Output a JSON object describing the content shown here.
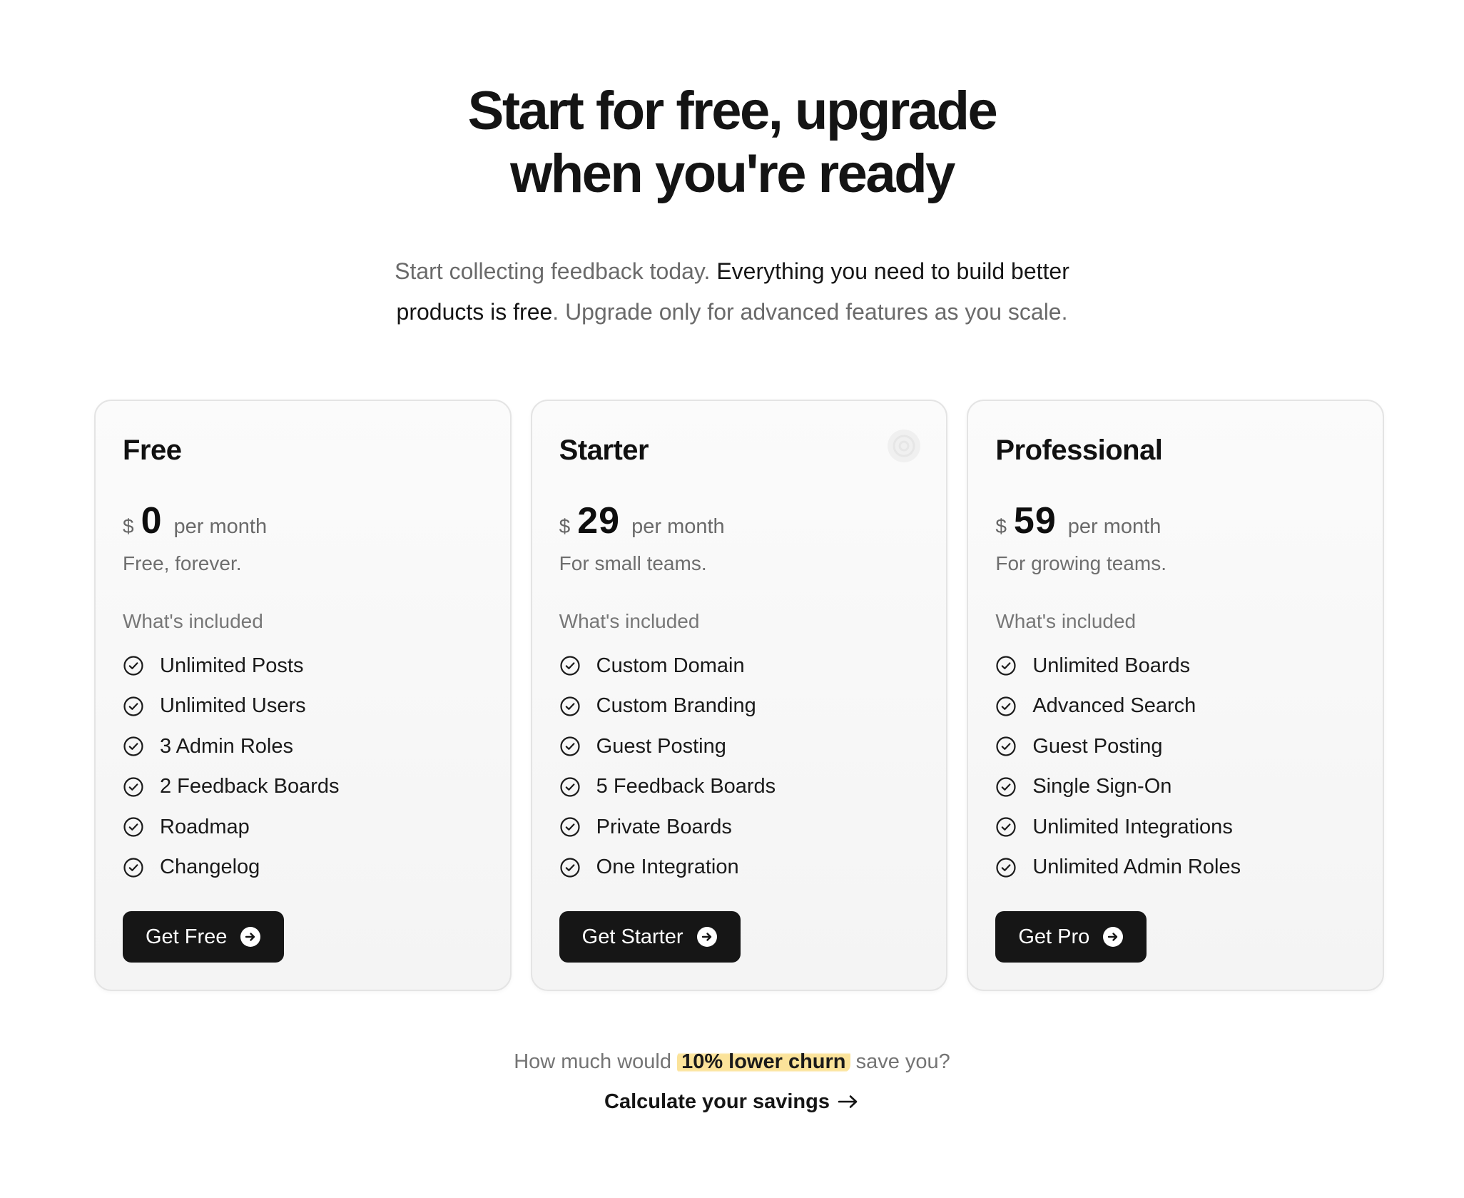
{
  "hero": {
    "title_line1": "Start for free, upgrade",
    "title_line2": "when you're ready",
    "subtitle_part1": "Start collecting feedback today. ",
    "subtitle_bold1": "Everything you need to build better",
    "subtitle_bold2": "products is free",
    "subtitle_part2": ". Upgrade only for advanced features as you scale."
  },
  "plans": [
    {
      "name": "Free",
      "currency": "$",
      "amount": "0",
      "period": "per month",
      "tagline": "Free, forever.",
      "included_label": "What's included",
      "features": [
        "Unlimited Posts",
        "Unlimited Users",
        "3 Admin Roles",
        "2 Feedback Boards",
        "Roadmap",
        "Changelog"
      ],
      "cta": "Get Free"
    },
    {
      "name": "Starter",
      "currency": "$",
      "amount": "29",
      "period": "per month",
      "tagline": "For small teams.",
      "included_label": "What's included",
      "features": [
        "Custom Domain",
        "Custom Branding",
        "Guest Posting",
        "5 Feedback Boards",
        "Private Boards",
        "One Integration"
      ],
      "cta": "Get Starter"
    },
    {
      "name": "Professional",
      "currency": "$",
      "amount": "59",
      "period": "per month",
      "tagline": "For growing teams.",
      "included_label": "What's included",
      "features": [
        "Unlimited Boards",
        "Advanced Search",
        "Guest Posting",
        "Single Sign-On",
        "Unlimited Integrations",
        "Unlimited Admin Roles"
      ],
      "cta": "Get Pro"
    }
  ],
  "churn": {
    "before": "How much would ",
    "highlight": "10% lower churn",
    "after": " save you?"
  },
  "calc_link": "Calculate your savings",
  "icons": {
    "feature": "check-circle-icon",
    "cta": "arrow-circle-right-icon",
    "link": "arrow-right-icon",
    "starter_deco": "target-icon"
  },
  "colors": {
    "button_bg": "#161616",
    "highlight": "#fbe39a",
    "card_border": "#e4e4e4"
  }
}
